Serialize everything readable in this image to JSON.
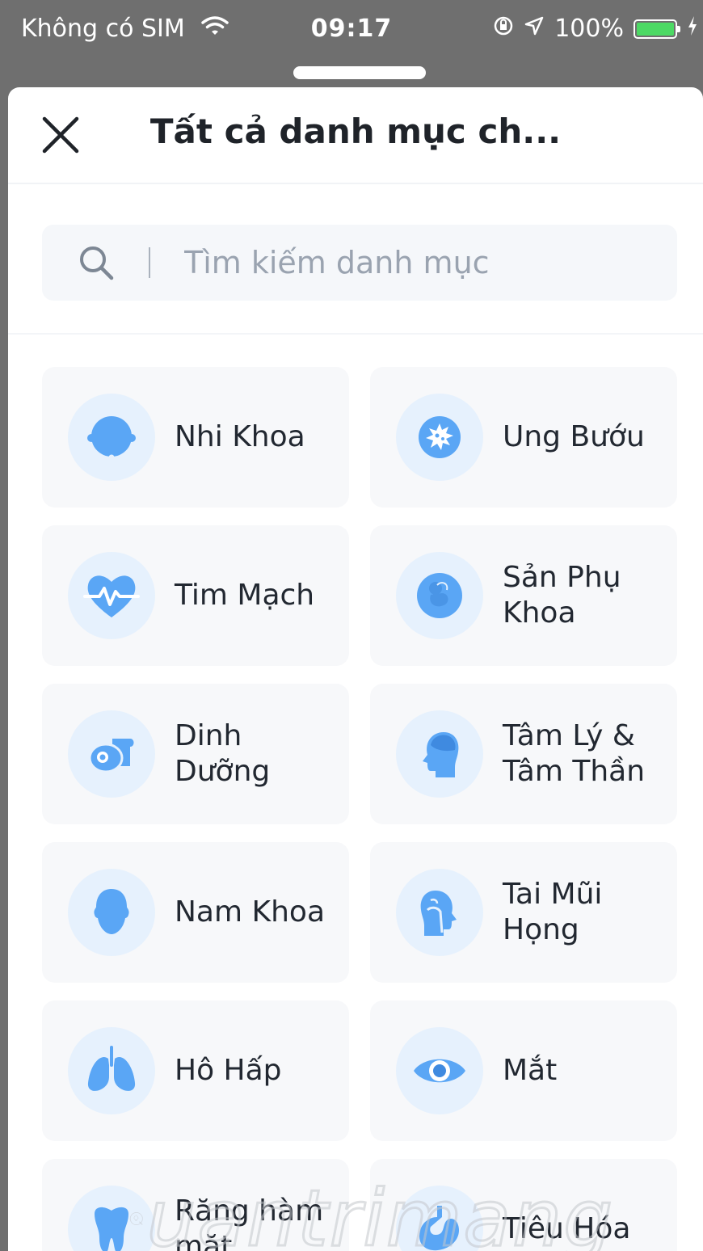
{
  "status_bar": {
    "carrier": "Không có SIM",
    "time": "09:17",
    "battery": "100%",
    "battery_color": "#4cd964"
  },
  "header": {
    "title": "Tất cả danh mục ch...",
    "close_icon": "close-icon"
  },
  "search": {
    "placeholder": "Tìm kiếm danh mục",
    "value": ""
  },
  "colors": {
    "accent": "#5aa6f5",
    "icon_bg": "#e6f1fd",
    "card_bg": "#f7f8fa"
  },
  "categories": [
    {
      "label": "Nhi Khoa",
      "icon": "baby-head-icon"
    },
    {
      "label": "Ung Bướu",
      "icon": "cancer-cell-icon"
    },
    {
      "label": "Tim Mạch",
      "icon": "heart-pulse-icon"
    },
    {
      "label": "Sản Phụ Khoa",
      "icon": "fetus-icon"
    },
    {
      "label": "Dinh Dưỡng",
      "icon": "egg-bread-icon"
    },
    {
      "label": "Tâm Lý & Tâm Thần",
      "icon": "head-brain-icon"
    },
    {
      "label": "Nam Khoa",
      "icon": "male-head-icon"
    },
    {
      "label": "Tai Mũi Họng",
      "icon": "ent-head-icon"
    },
    {
      "label": "Hô Hấp",
      "icon": "lungs-icon"
    },
    {
      "label": "Mắt",
      "icon": "eye-icon"
    },
    {
      "label": "Răng hàm mặt",
      "icon": "tooth-icon"
    },
    {
      "label": "Tiêu Hóa",
      "icon": "stomach-icon"
    }
  ],
  "watermark": "uantrimang"
}
